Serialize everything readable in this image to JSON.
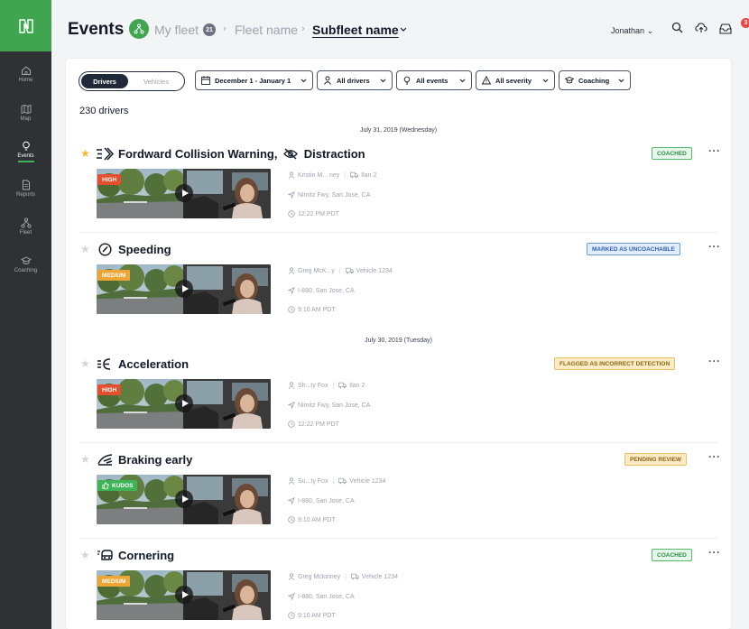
{
  "colors": {
    "brand_green": "#3fa64f",
    "sidebar_bg": "#2f3135",
    "notification": "#ef4444"
  },
  "sidebar": {
    "logo_icon": "n-logo-icon",
    "items": [
      {
        "label": "Home",
        "icon": "home-icon"
      },
      {
        "label": "Map",
        "icon": "map-icon"
      },
      {
        "label": "Events",
        "icon": "lightbulb-icon",
        "active": true
      },
      {
        "label": "Reports",
        "icon": "document-icon"
      },
      {
        "label": "Fleet",
        "icon": "hierarchy-icon"
      },
      {
        "label": "Coaching",
        "icon": "graduation-cap-icon"
      }
    ]
  },
  "header": {
    "title": "Events",
    "breadcrumb": {
      "my_fleet": "My fleet",
      "my_fleet_count": "21",
      "fleet_name": "Fleet name",
      "subfleet_name": "Subfleet name"
    },
    "user": "Jonathan",
    "notification_count": "3"
  },
  "filters": {
    "toggle": {
      "drivers": "Drivers",
      "vehicles": "Vehicles",
      "selected": "Drivers"
    },
    "date_range": "December 1 - January 1",
    "drivers": "All drivers",
    "events": "All events",
    "severity": "All severity",
    "coaching": "Coaching"
  },
  "driver_count": "230 drivers",
  "date_groups": [
    "July 31, 2019 (Wednesday)",
    "July 30, 2019 (Tuesday)"
  ],
  "events": [
    {
      "title": "Fordward Collision Warning,",
      "title2": "Distraction",
      "starred": true,
      "status": "COACHED",
      "severity": "HIGH",
      "driver": "Kristin M... ney",
      "vehicle": "Ilan 2",
      "location": "Nimitz Fwy, San Jose, CA",
      "time": "12:22 PM PDT"
    },
    {
      "title": "Speeding",
      "starred": false,
      "status": "MARKED AS UNCOACHABLE",
      "severity": "MEDIUM",
      "driver": "Greg McK...y",
      "vehicle": "Vehicle 1234",
      "location": "I-880, San Jose, CA",
      "time": "9:10 AM PDT"
    },
    {
      "title": "Acceleration",
      "starred": false,
      "status": "FLAGGED AS INCORRECT DETECTION",
      "severity": "HIGH",
      "driver": "Sh...ty Fox",
      "vehicle": "Ilan 2",
      "location": "Nimitz Fwy, San Jose, CA",
      "time": "12:22 PM PDT"
    },
    {
      "title": "Braking early",
      "starred": false,
      "status": "PENDING REVIEW",
      "severity": "KUDOS",
      "driver": "Su...ty Fox",
      "vehicle": "Vehicle 1234",
      "location": "I-880, San Jose, CA",
      "time": "9:10 AM PDT"
    },
    {
      "title": "Cornering",
      "starred": false,
      "status": "COACHED",
      "severity": "MEDIUM",
      "driver": "Greg Mckinney",
      "vehicle": "Vehicle 1234",
      "location": "I-880, San Jose, CA",
      "time": "9:10 AM PDT"
    }
  ]
}
